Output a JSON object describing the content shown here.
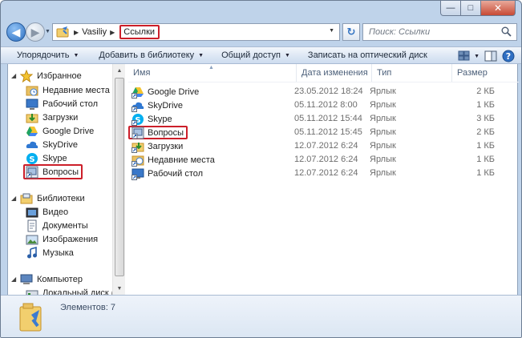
{
  "window": {
    "minimize_glyph": "—",
    "maximize_glyph": "□",
    "close_glyph": "✕"
  },
  "address": {
    "crumbs": [
      "Vasiliy",
      "Ссылки"
    ],
    "search_placeholder": "Поиск: Ссылки"
  },
  "toolbar": {
    "organize": "Упорядочить",
    "add_to_library": "Добавить в библиотеку",
    "share": "Общий доступ",
    "burn": "Записать на оптический диск"
  },
  "nav": {
    "favorites_header": "Избранное",
    "favorites": [
      "Недавние места",
      "Рабочий стол",
      "Загрузки",
      "Google Drive",
      "SkyDrive",
      "Skype",
      "Вопросы"
    ],
    "libraries_header": "Библиотеки",
    "libraries": [
      "Видео",
      "Документы",
      "Изображения",
      "Музыка"
    ],
    "computer_header": "Компьютер",
    "computer": [
      "Локальный диск (C"
    ]
  },
  "columns": {
    "name": "Имя",
    "date": "Дата изменения",
    "type": "Тип",
    "size": "Размер"
  },
  "files": [
    {
      "name": "Google Drive",
      "date": "23.05.2012 18:24",
      "type": "Ярлык",
      "size": "2 КБ"
    },
    {
      "name": "SkyDrive",
      "date": "05.11.2012 8:00",
      "type": "Ярлык",
      "size": "1 КБ"
    },
    {
      "name": "Skype",
      "date": "05.11.2012 15:44",
      "type": "Ярлык",
      "size": "3 КБ"
    },
    {
      "name": "Вопросы",
      "date": "05.11.2012 15:45",
      "type": "Ярлык",
      "size": "2 КБ"
    },
    {
      "name": "Загрузки",
      "date": "12.07.2012 6:24",
      "type": "Ярлык",
      "size": "1 КБ"
    },
    {
      "name": "Недавние места",
      "date": "12.07.2012 6:24",
      "type": "Ярлык",
      "size": "1 КБ"
    },
    {
      "name": "Рабочий стол",
      "date": "12.07.2012 6:24",
      "type": "Ярлык",
      "size": "1 КБ"
    }
  ],
  "details": {
    "count_text": "Элементов: 7"
  },
  "colors": {
    "highlight_border": "#cc1f2a",
    "toolbar_top": "#f3f7fc",
    "frame": "#bfd3ea"
  }
}
